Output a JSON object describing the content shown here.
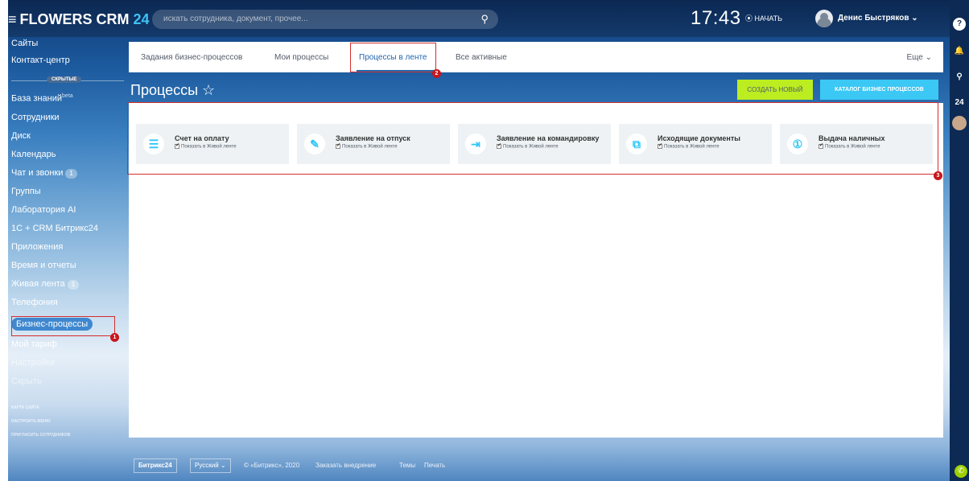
{
  "header": {
    "logo_main": "FLOWERS CRM",
    "logo_number": "24",
    "search_placeholder": "искать сотрудника, документ, прочее...",
    "clock": "17:43",
    "start_label": "НАЧАТЬ",
    "user_name": "Денис Быстряков"
  },
  "sidebar": {
    "top_items": [
      "Сайты",
      "Контакт-центр"
    ],
    "hidden_label": "СКРЫТЫЕ",
    "knowledge_base": "База знаний",
    "knowledge_beta": "beta",
    "items": [
      {
        "label": "Сотрудники",
        "counter": ""
      },
      {
        "label": "Диск",
        "counter": ""
      },
      {
        "label": "Календарь",
        "counter": ""
      },
      {
        "label": "Чат и звонки",
        "counter": "1"
      },
      {
        "label": "Группы",
        "counter": ""
      },
      {
        "label": "Лаборатория AI",
        "counter": ""
      },
      {
        "label": "1С + CRM Битрикс24",
        "counter": ""
      },
      {
        "label": "Приложения",
        "counter": ""
      },
      {
        "label": "Время и отчеты",
        "counter": ""
      },
      {
        "label": "Живая лента",
        "counter": "1"
      },
      {
        "label": "Телефония",
        "counter": ""
      }
    ],
    "active_item": "Бизнес-процессы",
    "after_items": [
      "Мой тариф",
      "Настройки",
      "Скрыть"
    ],
    "footer_links": [
      "КАРТА САЙТА",
      "НАСТРОИТЬ МЕНЮ",
      "ПРИГЛАСИТЬ СОТРУДНИКОВ"
    ]
  },
  "tabs": [
    {
      "label": "Задания бизнес-процессов"
    },
    {
      "label": "Мои процессы"
    },
    {
      "label": "Процессы в ленте"
    },
    {
      "label": "Все активные"
    }
  ],
  "more_label": "Еще",
  "page": {
    "title": "Процессы",
    "create_button": "СОЗДАТЬ НОВЫЙ",
    "catalog_button": "КАТАЛОГ БИЗНЕС ПРОЦЕССОВ"
  },
  "cards": [
    {
      "title": "Счет на оплату",
      "check_label": "Показать в Живой ленте",
      "icon": "invoice-icon"
    },
    {
      "title": "Заявление на отпуск",
      "check_label": "Показать в Живой ленте",
      "icon": "edit-icon"
    },
    {
      "title": "Заявление на командировку",
      "check_label": "Показать в Живой ленте",
      "icon": "trip-icon"
    },
    {
      "title": "Исходящие документы",
      "check_label": "Показать в Живой ленте",
      "icon": "documents-icon"
    },
    {
      "title": "Выдача наличных",
      "check_label": "Показать в Живой ленте",
      "icon": "cash-icon"
    }
  ],
  "annotations": [
    "1",
    "2",
    "3"
  ],
  "footer": {
    "brand": "Битрикс24",
    "language": "Русский",
    "copyright": "© «Битрикс», 2020",
    "order": "Заказать внедрение",
    "themes": "Темы",
    "print": "Печать"
  },
  "right_panel": {
    "help": "?",
    "counter": "24"
  },
  "colors": {
    "accent": "#2067b0",
    "create_button": "#bbed21",
    "catalog_button": "#3bc8f5",
    "annotation_red": "#c8161d"
  }
}
